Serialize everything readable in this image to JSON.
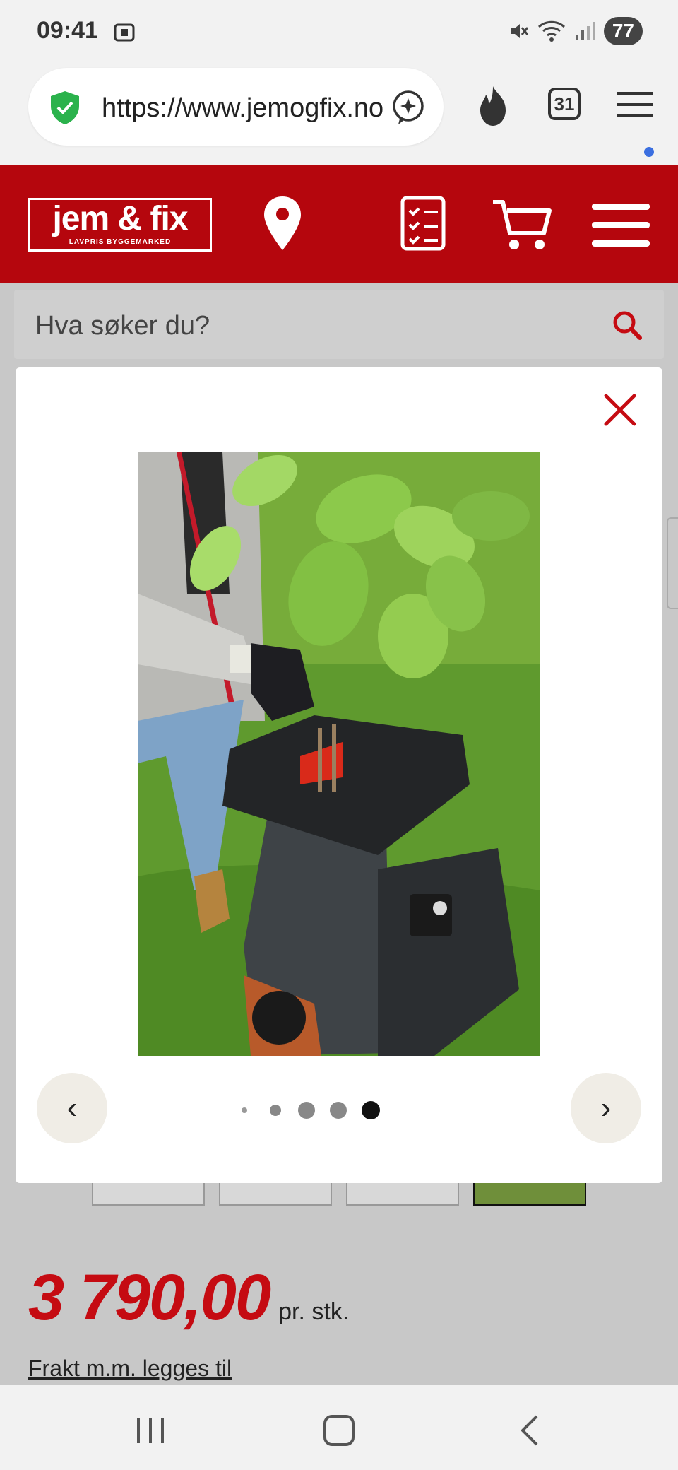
{
  "status_bar": {
    "time": "09:41",
    "battery": "77"
  },
  "browser": {
    "url": "https://www.jemogfix.no",
    "tabs_count": "31"
  },
  "site": {
    "logo_main": "jem & fix",
    "logo_sub": "LAVPRIS BYGGEMARKED",
    "brand_color": "#b5060d"
  },
  "search": {
    "placeholder": "Hva søker du?"
  },
  "gallery": {
    "prev_label": "‹",
    "next_label": "›",
    "dot_count": 5,
    "active_index": 4
  },
  "product": {
    "price": "3 790,00",
    "price_unit": "pr. stk.",
    "freight_link": "Frakt m.m. legges til"
  }
}
